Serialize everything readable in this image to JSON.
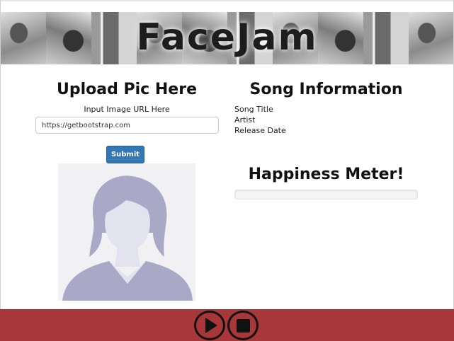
{
  "header": {
    "title": "FaceJam"
  },
  "upload": {
    "heading": "Upload Pic Here",
    "url_label": "Input Image URL Here",
    "url_value": "https://getbootstrap.com",
    "submit_label": "Submit"
  },
  "song": {
    "heading": "Song Information",
    "title_label": "Song Title",
    "artist_label": "Artist",
    "release_label": "Release Date"
  },
  "happiness": {
    "heading": "Happiness Meter!",
    "level": 0
  },
  "player": {
    "play_icon": "play-icon",
    "stop_icon": "stop-icon"
  },
  "colors": {
    "footer": "#a8373a",
    "primary": "#3278b4",
    "avatar_silhouette": "#a9a9c7"
  }
}
